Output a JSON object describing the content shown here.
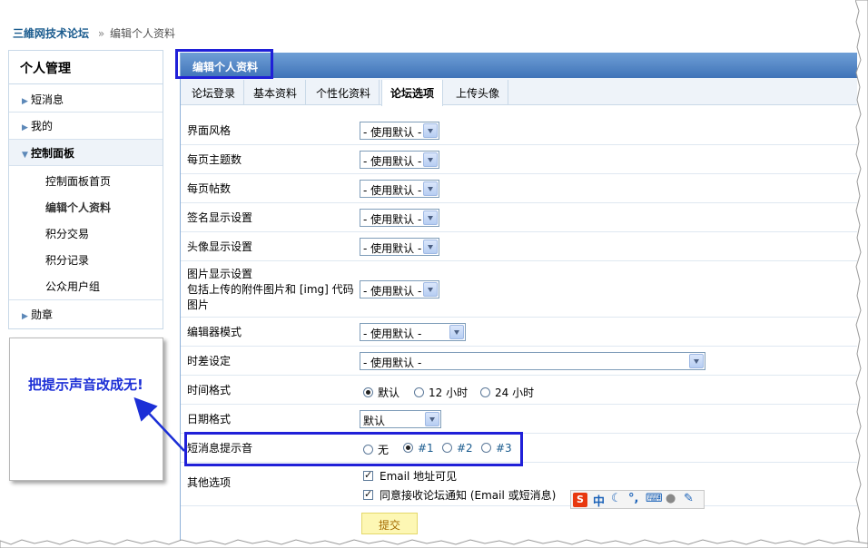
{
  "breadcrumb": {
    "site": "三維网技术论坛",
    "separator": "»",
    "current": "编辑个人资料"
  },
  "sidebar": {
    "title": "个人管理",
    "items": [
      {
        "label": "短消息"
      },
      {
        "label": "我的"
      },
      {
        "label": "控制面板"
      },
      {
        "label": "勋章"
      }
    ],
    "subitems": [
      {
        "label": "控制面板首页"
      },
      {
        "label": "编辑个人资料"
      },
      {
        "label": "积分交易"
      },
      {
        "label": "积分记录"
      },
      {
        "label": "公众用户组"
      }
    ]
  },
  "note": {
    "text": "把提示声音改成无!"
  },
  "main": {
    "title": "编辑个人资料",
    "tabs": [
      {
        "label": "论坛登录"
      },
      {
        "label": "基本资料"
      },
      {
        "label": "个性化资料"
      },
      {
        "label": "论坛选项"
      },
      {
        "label": "上传头像"
      }
    ],
    "rows": {
      "style": {
        "label": "界面风格",
        "value": "- 使用默认 -"
      },
      "tpp": {
        "label": "每页主题数",
        "value": "- 使用默认 -"
      },
      "ppp": {
        "label": "每页帖数",
        "value": "- 使用默认 -"
      },
      "sig": {
        "label": "签名显示设置",
        "value": "- 使用默认 -"
      },
      "avatar": {
        "label": "头像显示设置",
        "value": "- 使用默认 -"
      },
      "image": {
        "label_1": "图片显示设置",
        "label_2": "包括上传的附件图片和 [img] 代码",
        "label_3": "图片",
        "value": "- 使用默认 -"
      },
      "editor": {
        "label": "编辑器模式",
        "value": "- 使用默认 -"
      },
      "timezone": {
        "label": "时差设定",
        "value": "- 使用默认 -"
      },
      "timeformat": {
        "label": "时间格式",
        "options": [
          "默认",
          "12 小时",
          "24 小时"
        ]
      },
      "dateformat": {
        "label": "日期格式",
        "value": "默认"
      },
      "pmsound": {
        "label": "短消息提示音",
        "options": [
          "无",
          "#1",
          "#2",
          "#3"
        ]
      },
      "other": {
        "label": "其他选项",
        "check_1": "Email 地址可见",
        "check_2": "同意接收论坛通知 (Email 或短消息)"
      }
    },
    "submit_label": "提交"
  },
  "ime_toolbar": {
    "logo": "S",
    "mode": "中"
  },
  "colors": {
    "header": "#4f84c4",
    "highlight": "#2020d8",
    "note_text": "#1c2fd6",
    "link": "#1a5b8e"
  }
}
